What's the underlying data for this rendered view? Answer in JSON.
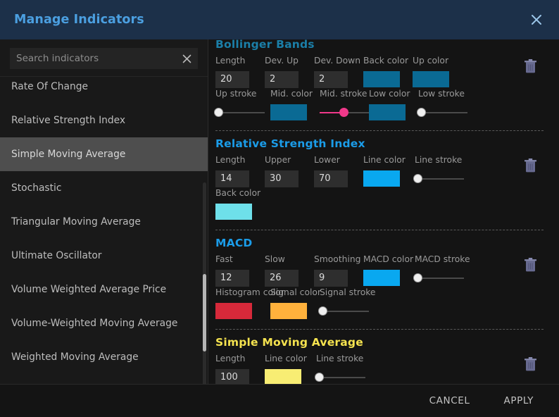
{
  "header": {
    "title": "Manage Indicators",
    "close_icon": "close-icon"
  },
  "sidebar": {
    "search": {
      "placeholder": "Search indicators",
      "value": "",
      "clear_icon": "close-icon"
    },
    "items": [
      {
        "label": "Rate Of Change",
        "selected": false
      },
      {
        "label": "Relative Strength Index",
        "selected": false
      },
      {
        "label": "Simple Moving Average",
        "selected": true
      },
      {
        "label": "Stochastic",
        "selected": false
      },
      {
        "label": "Triangular Moving Average",
        "selected": false
      },
      {
        "label": "Ultimate Oscillator",
        "selected": false
      },
      {
        "label": "Volume Weighted Average Price",
        "selected": false
      },
      {
        "label": "Volume-Weighted Moving Average",
        "selected": false
      },
      {
        "label": "Weighted Moving Average",
        "selected": false
      }
    ]
  },
  "sections": [
    {
      "title": "Bollinger Bands",
      "title_color": "#1b7fa8",
      "delete_icon": "trash-icon",
      "fields": [
        {
          "label": "Length",
          "type": "number",
          "value": "20"
        },
        {
          "label": "Dev. Up",
          "type": "number",
          "value": "2"
        },
        {
          "label": "Dev. Down",
          "type": "number",
          "value": "2"
        },
        {
          "label": "Back color",
          "type": "color",
          "value": "#0a6a94"
        },
        {
          "label": "Up color",
          "type": "color",
          "value": "#0a6a94"
        },
        {
          "label": "Up stroke",
          "type": "slider",
          "value": 5,
          "thumb_color": "#efefef",
          "fill_color": "#4a4a4a"
        },
        {
          "label": "Mid. color",
          "type": "color",
          "value": "#0a6a94"
        },
        {
          "label": "Mid. stroke",
          "type": "slider",
          "value": 48,
          "thumb_color": "#f0398a",
          "fill_color": "#f0398a"
        },
        {
          "label": "Low color",
          "type": "color",
          "value": "#0a6a94"
        },
        {
          "label": "Low stroke",
          "type": "slider",
          "value": 5,
          "thumb_color": "#efefef",
          "fill_color": "#4a4a4a"
        }
      ]
    },
    {
      "title": "Relative Strength Index",
      "title_color": "#1b9ce8",
      "delete_icon": "trash-icon",
      "fields": [
        {
          "label": "Length",
          "type": "number",
          "value": "14"
        },
        {
          "label": "Upper",
          "type": "number",
          "value": "30"
        },
        {
          "label": "Lower",
          "type": "number",
          "value": "70"
        },
        {
          "label": "Line color",
          "type": "color",
          "value": "#09a8f0"
        },
        {
          "label": "Line stroke",
          "type": "slider",
          "value": 5,
          "thumb_color": "#efefef",
          "fill_color": "#4a4a4a"
        },
        {
          "label": "Back color",
          "type": "color",
          "value": "#6ee0ea"
        }
      ]
    },
    {
      "title": "MACD",
      "title_color": "#1b9ce8",
      "delete_icon": "trash-icon",
      "fields": [
        {
          "label": "Fast",
          "type": "number",
          "value": "12"
        },
        {
          "label": "Slow",
          "type": "number",
          "value": "26"
        },
        {
          "label": "Smoothing",
          "type": "number",
          "value": "9"
        },
        {
          "label": "MACD color",
          "type": "color",
          "value": "#09a8f0"
        },
        {
          "label": "MACD stroke",
          "type": "slider",
          "value": 5,
          "thumb_color": "#efefef",
          "fill_color": "#4a4a4a"
        },
        {
          "label": "Histogram color",
          "type": "color",
          "value": "#d6293a"
        },
        {
          "label": "Signal color",
          "type": "color",
          "value": "#ffb13c"
        },
        {
          "label": "Signal stroke",
          "type": "slider",
          "value": 5,
          "thumb_color": "#efefef",
          "fill_color": "#4a4a4a"
        }
      ]
    },
    {
      "title": "Simple Moving Average",
      "title_color": "#f5e34f",
      "delete_icon": "trash-icon",
      "fields": [
        {
          "label": "Length",
          "type": "number",
          "value": "100"
        },
        {
          "label": "Line color",
          "type": "color",
          "value": "#f8ed73"
        },
        {
          "label": "Line stroke",
          "type": "slider",
          "value": 5,
          "thumb_color": "#efefef",
          "fill_color": "#4a4a4a"
        }
      ]
    }
  ],
  "footer": {
    "cancel_label": "CANCEL",
    "apply_label": "APPLY"
  }
}
